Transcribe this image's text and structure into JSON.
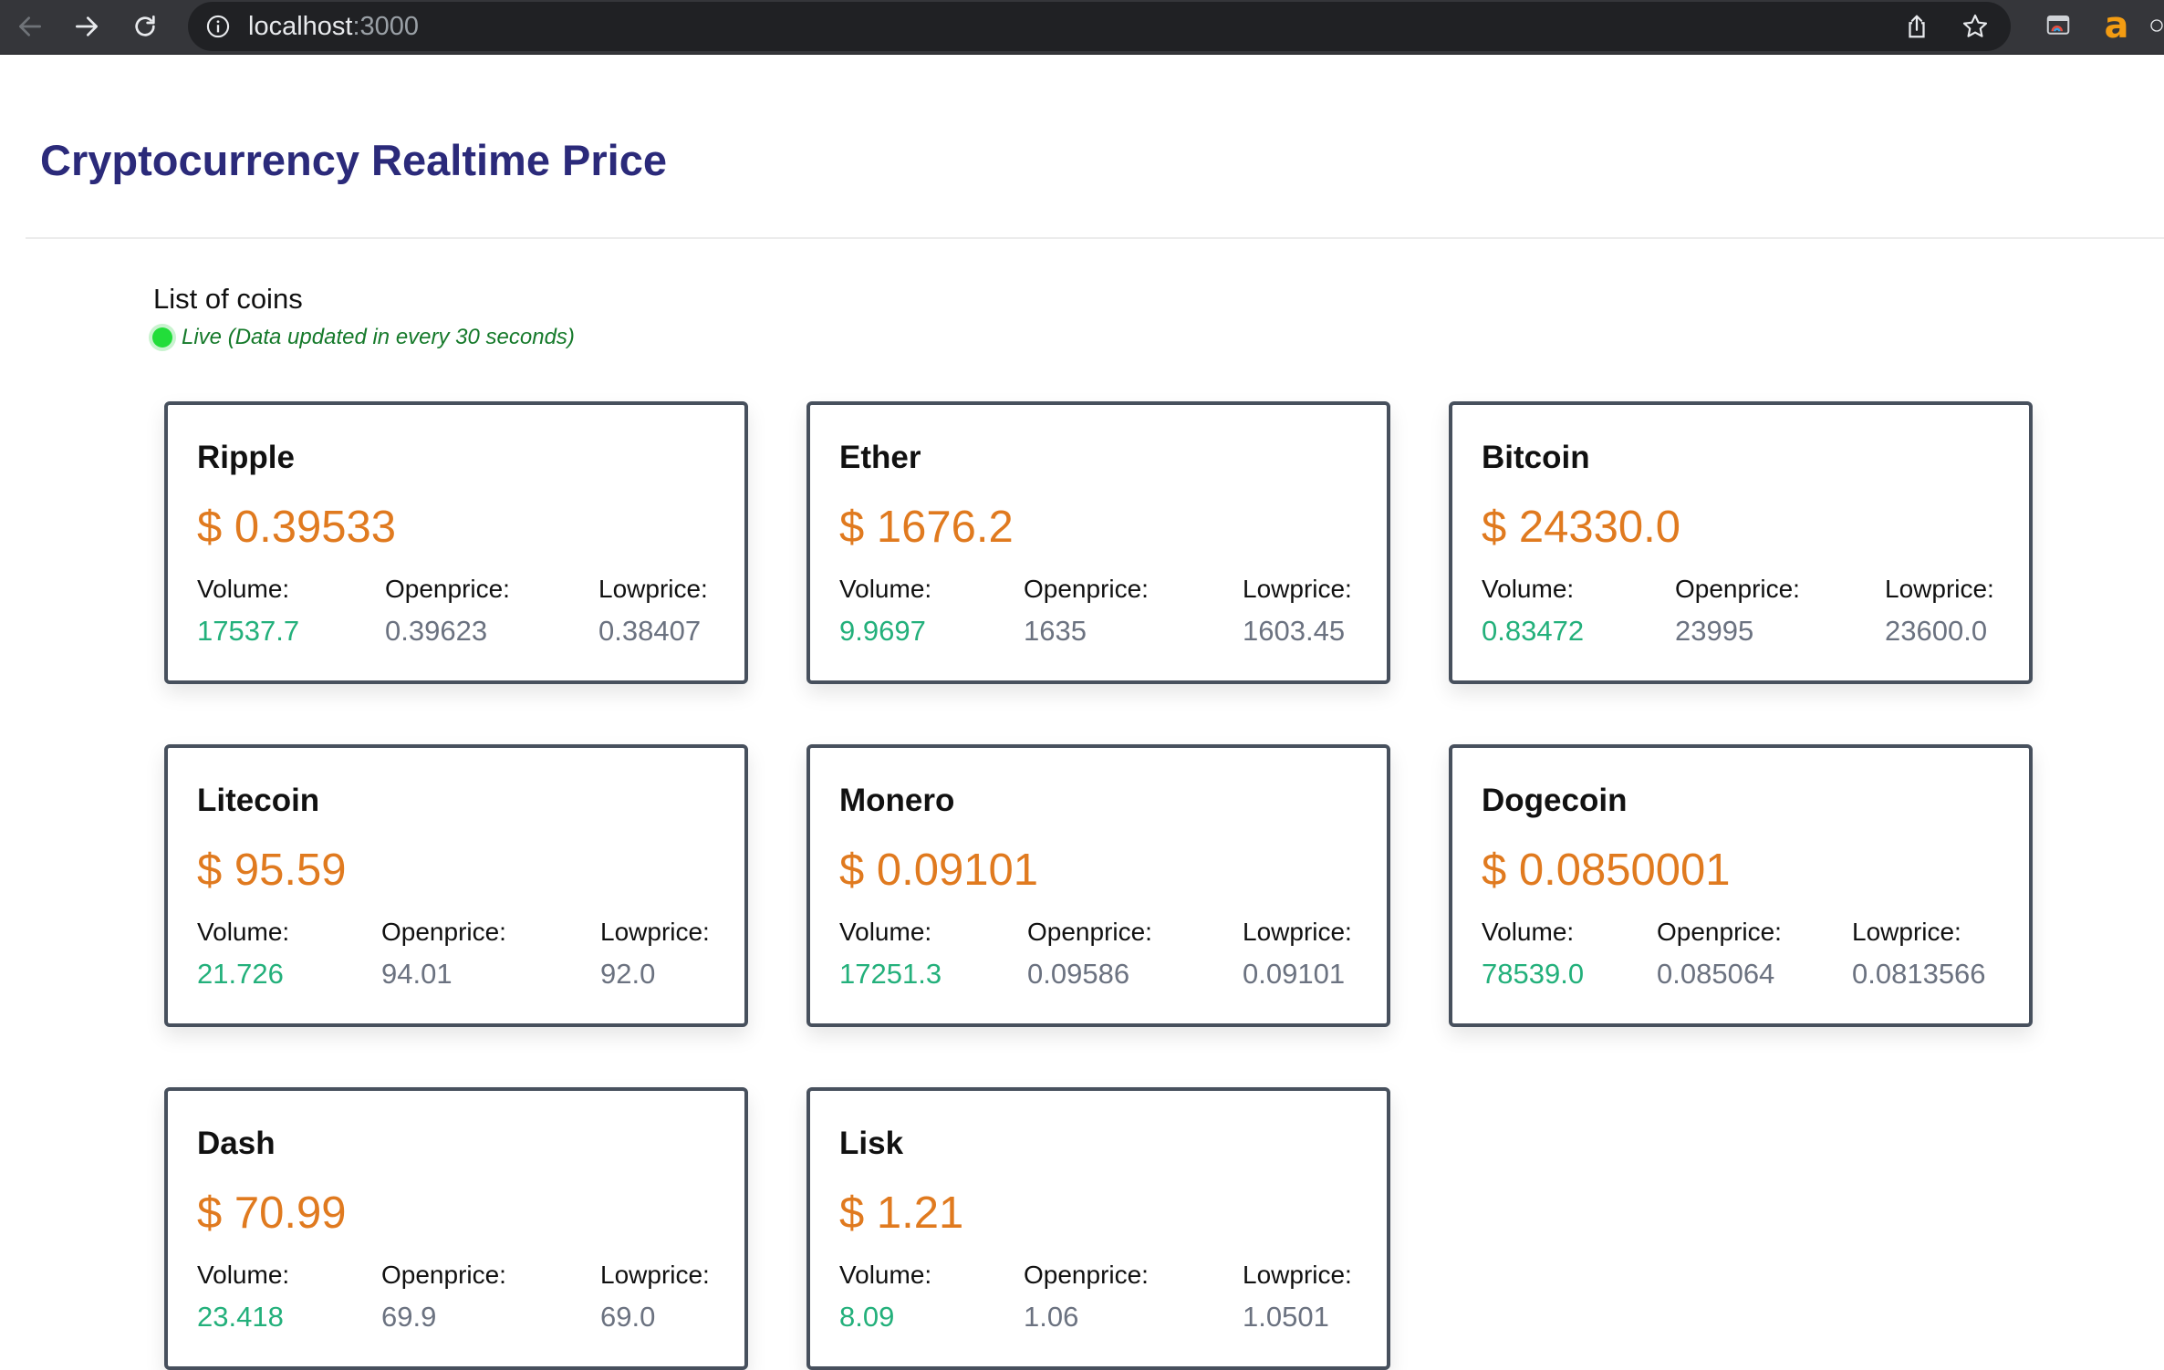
{
  "browser": {
    "url_host": "localhost",
    "url_port": ":3000"
  },
  "page": {
    "title": "Cryptocurrency Realtime Price",
    "list_title": "List of coins",
    "live_text": "Live (Data updated in every 30 seconds)"
  },
  "labels": {
    "volume": "Volume:",
    "openprice": "Openprice:",
    "lowprice": "Lowprice:"
  },
  "coins": [
    {
      "name": "Ripple",
      "price": "$ 0.39533",
      "volume": "17537.7",
      "openprice": "0.39623",
      "lowprice": "0.38407"
    },
    {
      "name": "Ether",
      "price": "$ 1676.2",
      "volume": "9.9697",
      "openprice": "1635",
      "lowprice": "1603.45"
    },
    {
      "name": "Bitcoin",
      "price": "$ 24330.0",
      "volume": "0.83472",
      "openprice": "23995",
      "lowprice": "23600.0"
    },
    {
      "name": "Litecoin",
      "price": "$ 95.59",
      "volume": "21.726",
      "openprice": "94.01",
      "lowprice": "92.0"
    },
    {
      "name": "Monero",
      "price": "$ 0.09101",
      "volume": "17251.3",
      "openprice": "0.09586",
      "lowprice": "0.09101"
    },
    {
      "name": "Dogecoin",
      "price": "$ 0.0850001",
      "volume": "78539.0",
      "openprice": "0.085064",
      "lowprice": "0.0813566"
    },
    {
      "name": "Dash",
      "price": "$ 70.99",
      "volume": "23.418",
      "openprice": "69.9",
      "lowprice": "69.0"
    },
    {
      "name": "Lisk",
      "price": "$ 1.21",
      "volume": "8.09",
      "openprice": "1.06",
      "lowprice": "1.0501"
    }
  ],
  "colors": {
    "title": "#2b2a7a",
    "price": "#e07a1f",
    "volume": "#23b07b",
    "muted_value": "#6b7280",
    "live": "#167a2b"
  },
  "icons": [
    "back-arrow-icon",
    "forward-arrow-icon",
    "reload-icon",
    "info-icon",
    "share-icon",
    "star-icon",
    "cast-extension-icon",
    "amazon-extension-icon"
  ]
}
